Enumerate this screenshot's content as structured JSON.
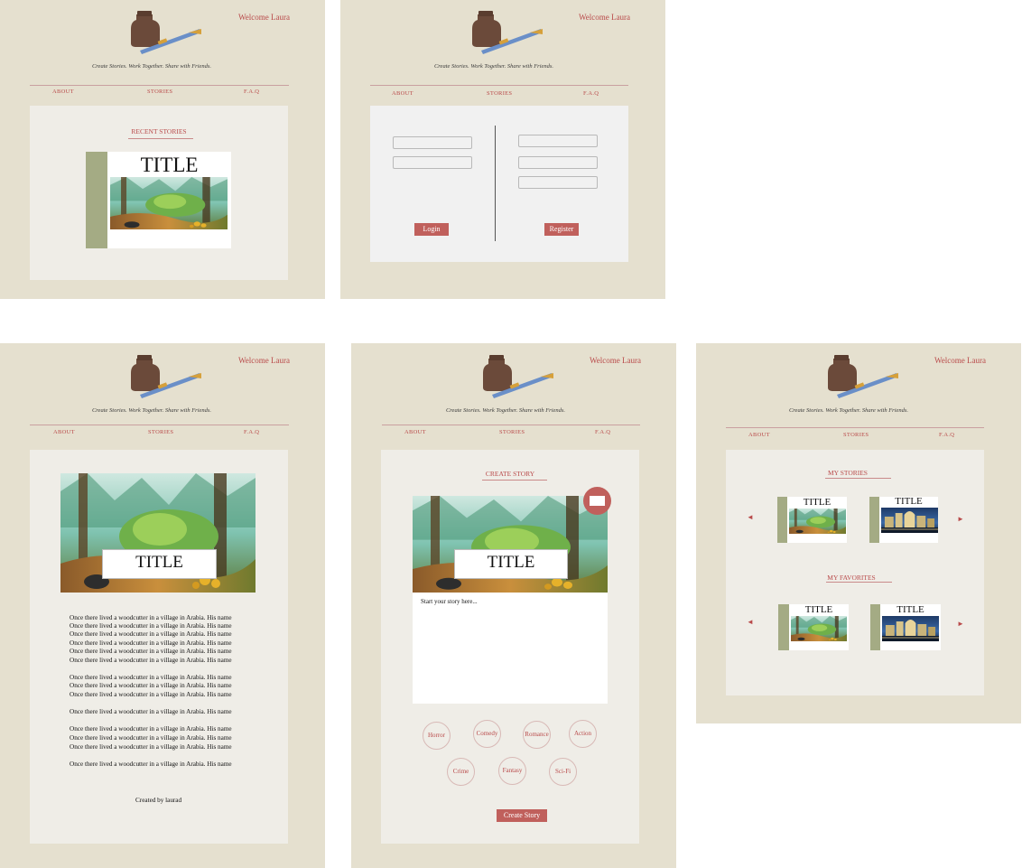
{
  "brand": {
    "tagline": "Create Stories.  Work Together.  Share with Friends.",
    "welcome": "Welcome Laura",
    "logo_icon": "inkwell-and-pen-icon"
  },
  "nav": {
    "about": "ABOUT",
    "stories": "STORIES",
    "faq": "F.A.Q"
  },
  "colors": {
    "panel_bg": "#e5e0cf",
    "inner_bg": "#efede7",
    "accent": "#c0605c",
    "link_red": "#b94a4a",
    "spine_green": "#a4ab84"
  },
  "home": {
    "section_title": "RECENT STORIES",
    "card_title": "TITLE"
  },
  "auth": {
    "login_label": "Login",
    "register_label": "Register"
  },
  "story": {
    "title": "TITLE",
    "lines": [
      "Once there lived a woodcutter in a village in Arabia. His name",
      "Once there lived a woodcutter in a village in Arabia. His name",
      "Once there lived a woodcutter in a village in Arabia. His name",
      "Once there lived a woodcutter in a village in Arabia. His name",
      "Once there lived a woodcutter in a village in Arabia. His name",
      "Once there lived a woodcutter in a village in Arabia. His name",
      "Once there lived a woodcutter in a village in Arabia. His name",
      "Once there lived a woodcutter in a village in Arabia. His name",
      "Once there lived a woodcutter in a village in Arabia. His name",
      "Once there lived a woodcutter in a village in Arabia. His name",
      "Once there lived a woodcutter in a village in Arabia. His name",
      "Once there lived a woodcutter in a village in Arabia. His name",
      "Once there lived a woodcutter in a village in Arabia. His name",
      "Once there lived a woodcutter in a village in Arabia. His name"
    ],
    "created_by": "Created by laurad"
  },
  "create": {
    "section_title": "CREATE STORY",
    "title": "TITLE",
    "placeholder": "Start your story here...",
    "genres": [
      "Horror",
      "Comedy",
      "Romance",
      "Action",
      "Crime",
      "Fantasy",
      "Sci-Fi"
    ],
    "submit_label": "Create Story"
  },
  "profile": {
    "my_stories_title": "MY STORIES",
    "my_favorites_title": "MY FAVORITES",
    "card_title": "TITLE",
    "prev_arrow": "◄",
    "next_arrow": "►"
  }
}
